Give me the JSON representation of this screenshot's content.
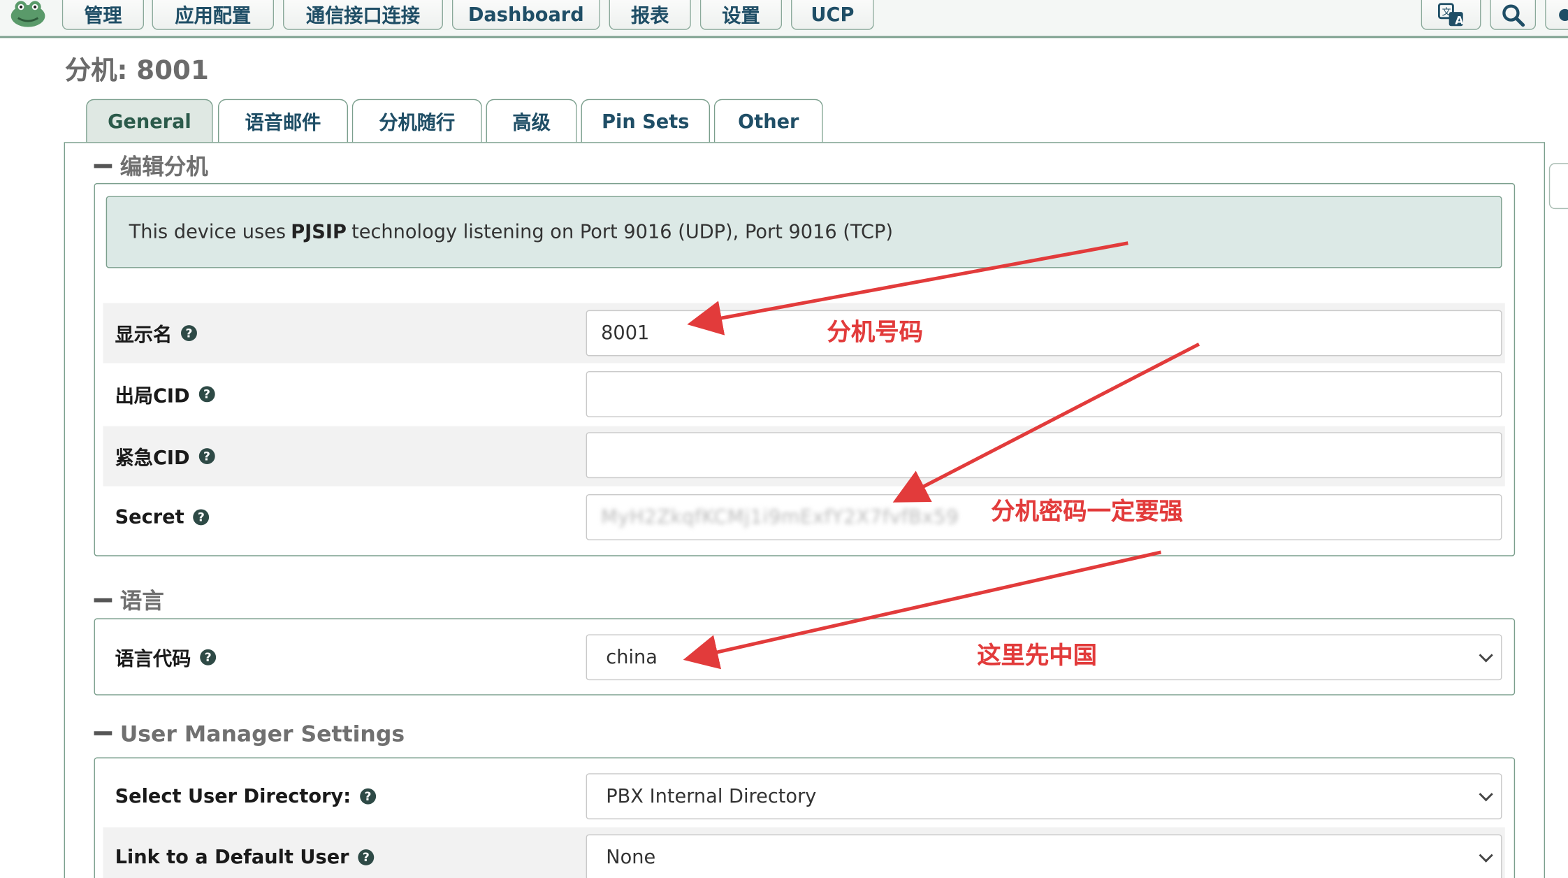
{
  "nav": {
    "items": [
      "管理",
      "应用配置",
      "通信接口连接",
      "Dashboard",
      "报表",
      "设置",
      "UCP"
    ]
  },
  "page_title": "分机: 8001",
  "tabs": [
    "General",
    "语音邮件",
    "分机随行",
    "高级",
    "Pin Sets",
    "Other"
  ],
  "active_tab": "General",
  "sections": {
    "edit": {
      "title": "编辑分机",
      "info": {
        "prefix": "This device uses",
        "tech": "PJSIP",
        "suffix": "technology listening on Port 9016 (UDP), Port 9016 (TCP)"
      },
      "rows": {
        "display_name": {
          "label": "显示名",
          "value": "8001"
        },
        "outbound_cid": {
          "label": "出局CID",
          "value": ""
        },
        "emergency_cid": {
          "label": "紧急CID",
          "value": ""
        },
        "secret": {
          "label": "Secret",
          "value": "MyH2ZkqfKCMj1i9mExfY2X7fvfBx59"
        }
      }
    },
    "language": {
      "title": "语言",
      "rows": {
        "language_code": {
          "label": "语言代码",
          "value": "china"
        }
      }
    },
    "user_manager": {
      "title": "User Manager Settings",
      "rows": {
        "user_directory": {
          "label": "Select User Directory:",
          "value": "PBX Internal Directory"
        },
        "default_user": {
          "label": "Link to a Default User",
          "value": "None"
        }
      }
    }
  },
  "annotations": {
    "ext_number": "分机号码",
    "strong_password": "分机密码一定要强",
    "language_note": "这里先中国"
  },
  "colors": {
    "accent_border": "#7b9f8d",
    "nav_text": "#1f4e66",
    "info_bg": "#dce9e6",
    "annotation_red": "#e23b3b"
  },
  "icons": {
    "logo": "frog-logo-icon",
    "translate": "translate-icon",
    "search": "search-icon",
    "help": "help-icon",
    "select": "chevron-down-icon"
  }
}
